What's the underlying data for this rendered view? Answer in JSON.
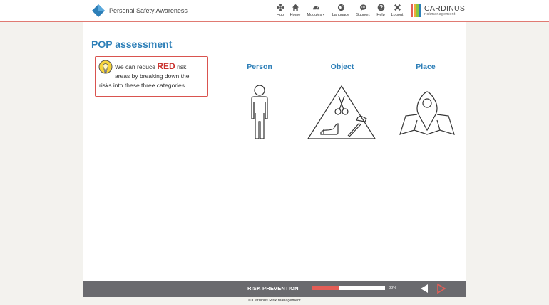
{
  "header": {
    "course_title": "Personal Safety Awareness",
    "nav": [
      {
        "label": "Hub",
        "icon": "hub-icon"
      },
      {
        "label": "Home",
        "icon": "home-icon"
      },
      {
        "label": "Modules ▾",
        "icon": "modules-icon"
      },
      {
        "label": "Language",
        "icon": "globe-icon"
      },
      {
        "label": "Support",
        "icon": "chat-icon"
      },
      {
        "label": "Help",
        "icon": "help-icon"
      },
      {
        "label": "Logout",
        "icon": "close-icon"
      }
    ],
    "brand": {
      "name": "CARDINUS",
      "sub": "riskmanagement",
      "bar_colors": [
        "#e35d56",
        "#f0a93b",
        "#8cc63e",
        "#2d7fb8"
      ]
    }
  },
  "main": {
    "title": "POP assessment",
    "info": {
      "before": "We can reduce",
      "highlight": "RED",
      "after": "risk",
      "line2": "areas by breaking down the",
      "line3": "risks into these three categories."
    },
    "categories": [
      {
        "label": "Person",
        "icon": "person-icon"
      },
      {
        "label": "Object",
        "icon": "object-hazard-icon"
      },
      {
        "label": "Place",
        "icon": "map-pin-icon"
      }
    ]
  },
  "footer": {
    "section": "RISK PREVENTION",
    "progress_percent": 38,
    "progress_text": "38%",
    "prev_icon": "prev-arrow-icon",
    "next_icon": "next-arrow-icon"
  },
  "copyright": "© Cardinus Risk Management",
  "colors": {
    "accent_blue": "#2d7fb8",
    "risk_red": "#c9302c",
    "progress_fill": "#e35d56",
    "footer_bg": "#6a6a6e"
  }
}
